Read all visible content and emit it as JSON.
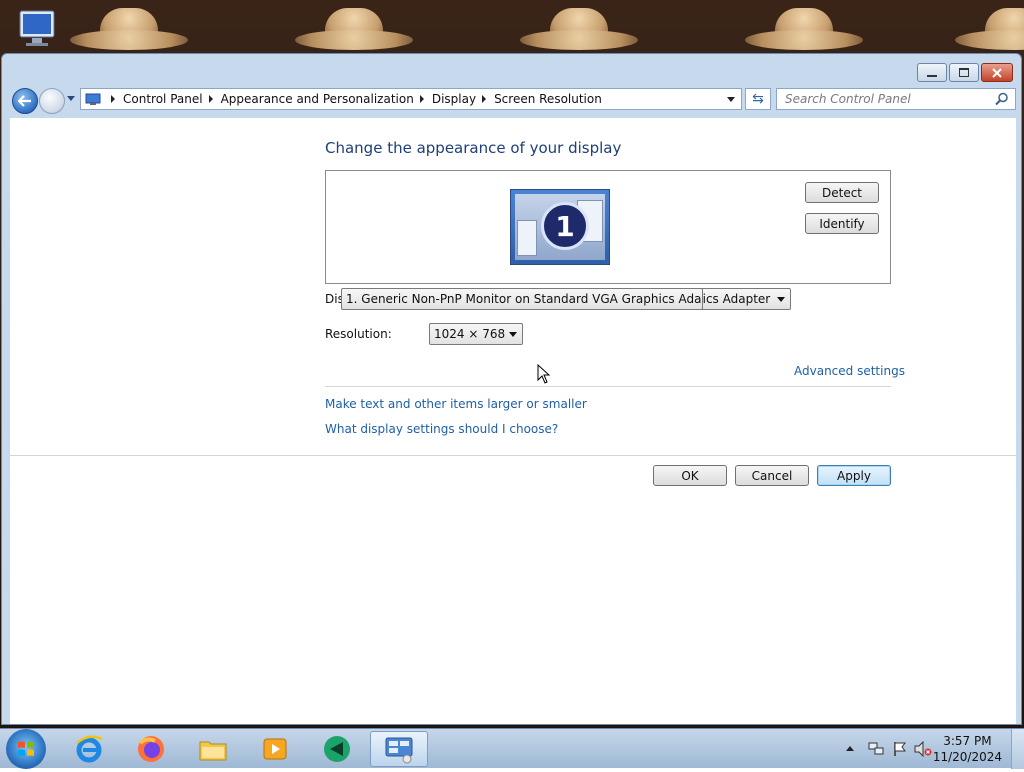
{
  "window": {
    "title": "Screen Resolution"
  },
  "breadcrumb": [
    "Control Panel",
    "Appearance and Personalization",
    "Display",
    "Screen Resolution"
  ],
  "search": {
    "placeholder": "Search Control Panel"
  },
  "main": {
    "heading": "Change the appearance of your display",
    "monitor_number": "1",
    "detect_label": "Detect",
    "identify_label": "Identify",
    "display_label": "Dis",
    "display_value": "1. Generic Non-PnP Monitor on Standard VGA Graphics Adapter",
    "display_value_behind": "hics Adapter",
    "resolution_label": "Resolution:",
    "resolution_value": "1024 × 768",
    "advanced_link": "Advanced settings",
    "text_size_link": "Make text and other items larger or smaller",
    "help_link": "What display settings should I choose?",
    "ok_label": "OK",
    "cancel_label": "Cancel",
    "apply_label": "Apply"
  },
  "taskbar": {
    "time": "3:57 PM",
    "date": "11/20/2024"
  }
}
